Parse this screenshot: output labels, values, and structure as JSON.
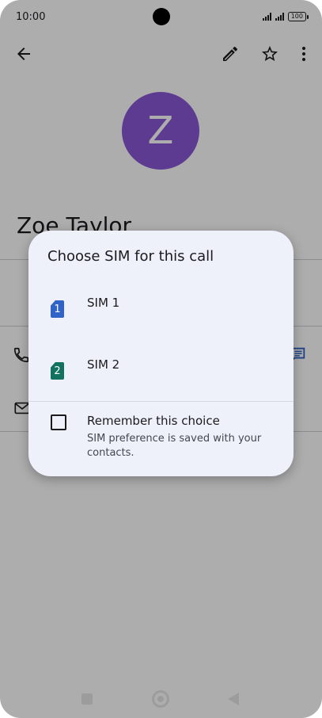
{
  "status_bar": {
    "time": "10:00",
    "battery": "100"
  },
  "contact": {
    "initial": "Z",
    "name": "Zoe Taylor"
  },
  "dialog": {
    "title": "Choose SIM for this call",
    "options": [
      {
        "badge": "1",
        "label": "SIM 1",
        "color": "#2f63c7"
      },
      {
        "badge": "2",
        "label": "SIM 2",
        "color": "#13725f"
      }
    ],
    "remember": {
      "title": "Remember this choice",
      "description": "SIM preference is saved with your contacts."
    }
  },
  "colors": {
    "avatar": "#8a57d6",
    "dialog_bg": "#eef0fa",
    "accent": "#2f63c7"
  },
  "icons": [
    "back-icon",
    "edit-icon",
    "star-icon",
    "more-vertical-icon",
    "phone-icon",
    "message-icon",
    "mail-icon"
  ]
}
